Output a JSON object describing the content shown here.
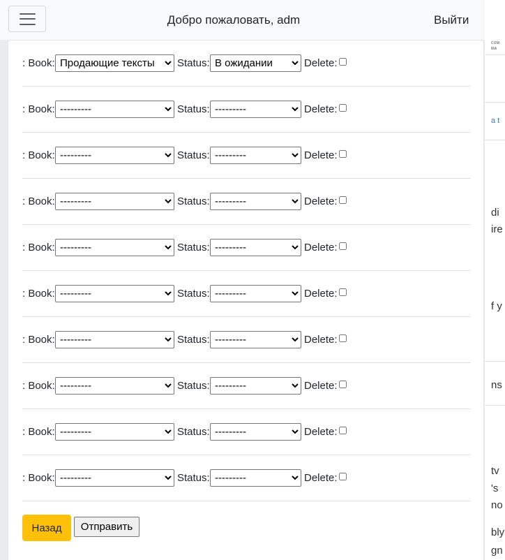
{
  "navbar": {
    "welcome_text": "Добро пожаловать, adm",
    "logout_label": "Выйти"
  },
  "form": {
    "book_label": ": Book:",
    "status_label": "Status:",
    "delete_label": "Delete:",
    "rows": [
      {
        "book": "Продающие тексты",
        "status": "В ожидании",
        "delete": false
      },
      {
        "book": "---------",
        "status": "---------",
        "delete": false
      },
      {
        "book": "---------",
        "status": "---------",
        "delete": false
      },
      {
        "book": "---------",
        "status": "---------",
        "delete": false
      },
      {
        "book": "---------",
        "status": "---------",
        "delete": false
      },
      {
        "book": "---------",
        "status": "---------",
        "delete": false
      },
      {
        "book": "---------",
        "status": "---------",
        "delete": false
      },
      {
        "book": "---------",
        "status": "---------",
        "delete": false
      },
      {
        "book": "---------",
        "status": "---------",
        "delete": false
      },
      {
        "book": "---------",
        "status": "---------",
        "delete": false
      }
    ],
    "back_label": "Назад",
    "submit_label": "Отправить"
  },
  "background_fragments": [
    "a t",
    "di",
    "ire",
    "f y",
    "ns",
    "tv",
    "'s",
    "no",
    "bly",
    "gn"
  ],
  "colors": {
    "back_button": "#ffc107",
    "navbar": "#f8f9fa"
  }
}
